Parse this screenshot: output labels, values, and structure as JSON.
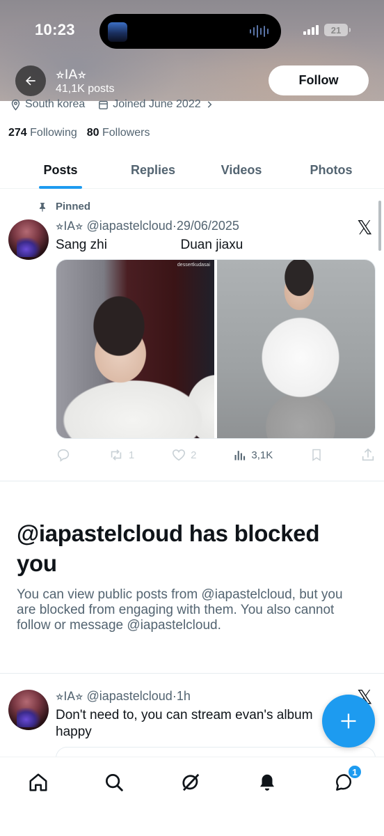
{
  "status_bar": {
    "time": "10:23",
    "battery": "21"
  },
  "header": {
    "display_name": "⭐︎IA⭐︎",
    "post_count": "41,1K posts",
    "follow_label": "Follow"
  },
  "profile": {
    "location": "South korea",
    "joined": "Joined June 2022",
    "following_count": "274",
    "following_label": "Following",
    "followers_count": "80",
    "followers_label": "Followers"
  },
  "tabs": [
    {
      "label": "Posts",
      "active": true
    },
    {
      "label": "Replies",
      "active": false
    },
    {
      "label": "Videos",
      "active": false
    },
    {
      "label": "Photos",
      "active": false
    }
  ],
  "pinned_tweet": {
    "pinned_label": "Pinned",
    "name": "⭐︎IA⭐︎",
    "handle": "@iapastelcloud",
    "sep": "·",
    "date": "29/06/2025",
    "text": "Sang zhi                    Duan jiaxu",
    "image_watermark": "dessertkudasai",
    "retweets": "1",
    "likes": "2",
    "views": "3,1K"
  },
  "blocked": {
    "title": "@iapastelcloud has blocked you",
    "body": "You can view public posts from @iapastelcloud, but you are blocked from engaging with them. You also cannot follow or message @iapastelcloud."
  },
  "second_tweet": {
    "name": "⭐︎IA⭐︎",
    "handle": "@iapastelcloud",
    "sep": "·",
    "time": "1h",
    "text_line1": "Don't need to, you can stream evan's album",
    "text_line2": "happy"
  },
  "bottom_nav": {
    "items": [
      "home-icon",
      "search-icon",
      "grok-icon",
      "notifications-icon",
      "messages-icon"
    ],
    "messages_badge": "1"
  },
  "colors": {
    "accent": "#1d9bf0",
    "text_primary": "#0f1419",
    "text_secondary": "#536471"
  }
}
